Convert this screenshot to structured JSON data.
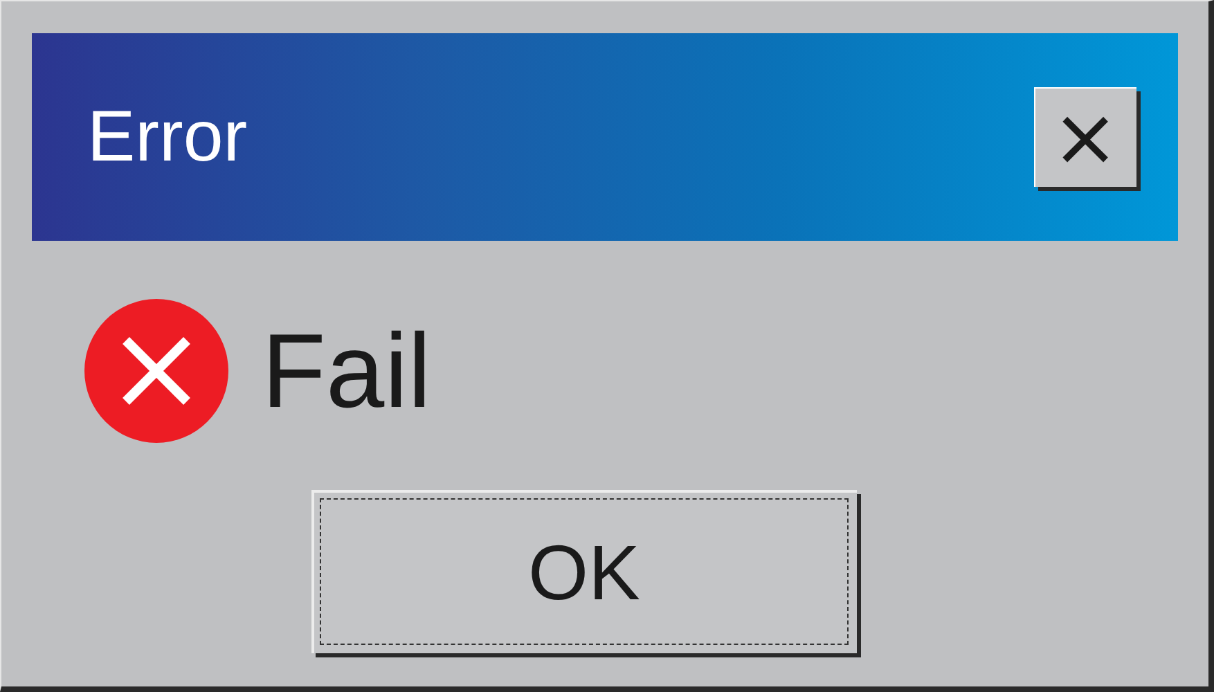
{
  "window": {
    "title": "Error",
    "close_label": "×"
  },
  "message": {
    "kind": "error",
    "text": "Fail"
  },
  "buttons": [
    {
      "label": "OK",
      "focused": true
    }
  ]
}
